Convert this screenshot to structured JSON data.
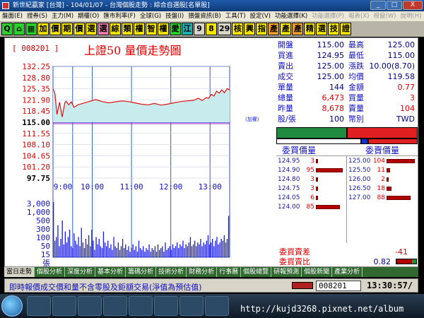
{
  "window": {
    "title": "新世紀贏家 [台灣] - 104/01/07 - 台灣個股走勢 : 綜合自選股[名單股]",
    "buttons": [
      "_",
      "□",
      "X"
    ]
  },
  "menu": [
    "盤面(E)",
    "證券(S)",
    "主力(M)",
    "期權(O)",
    "匯市利率(F)",
    "全球(G)",
    "技盤(I)",
    "損盤資訊(B)",
    "工具(T)",
    "設定(V)",
    "功能選擇(K)",
    "功能選擇(P)",
    "報表(X)",
    "視窗(W)",
    "說明(H)"
  ],
  "toolbar": [
    {
      "label": "Q",
      "color": "green"
    },
    {
      "label": "⌂",
      "color": "green"
    },
    {
      "label": "▦",
      "color": "green"
    },
    {
      "label": "加",
      "color": "yellow"
    },
    {
      "label": "價",
      "color": "yellow"
    },
    {
      "label": "期",
      "color": "yellow"
    },
    {
      "label": "價",
      "color": "yellow"
    },
    {
      "label": "選",
      "color": "yellow"
    },
    {
      "label": "選",
      "color": "pink"
    },
    {
      "label": "綜",
      "color": "yellow"
    },
    {
      "label": "類",
      "color": "yellow"
    },
    {
      "label": "權",
      "color": "yellow"
    },
    {
      "label": "智",
      "color": "yellow"
    },
    {
      "label": "權",
      "color": "yellow"
    },
    {
      "label": "愛",
      "color": "green"
    },
    {
      "label": "江",
      "color": "teal"
    },
    {
      "label": "9",
      "color": "lgray"
    },
    {
      "label": "8",
      "color": "yellow"
    },
    {
      "label": "29",
      "color": "lgray"
    },
    {
      "label": "核",
      "color": "yellow"
    },
    {
      "label": "興",
      "color": "yellow"
    },
    {
      "label": "指",
      "color": "yellow"
    },
    {
      "label": "產",
      "color": "orange"
    },
    {
      "label": "產",
      "color": "yellow"
    },
    {
      "label": "產",
      "color": "orange"
    },
    {
      "label": "精",
      "color": "yellow"
    },
    {
      "label": "選",
      "color": "yellow"
    },
    {
      "label": "技",
      "color": "yellow"
    },
    {
      "label": "證",
      "color": "yellow"
    }
  ],
  "stock_code": "[ 008201 ]",
  "chart_title": "上證50  量價走勢圖",
  "chart_data": {
    "type": "line",
    "price_axis": {
      "ticks": [
        132.25,
        128.8,
        125.35,
        121.9,
        118.45,
        115.0,
        111.55,
        108.1,
        104.65,
        101.2,
        97.75
      ],
      "tick_labels": [
        "132.25",
        "128.80",
        "125.35",
        "121.90",
        "118.45",
        "115.00",
        "111.55",
        "108.10",
        "104.65",
        "101.20",
        "97.75"
      ],
      "range": [
        97.75,
        132.25
      ],
      "reference": 115.0,
      "reference_note": "(加權)"
    },
    "volume_axis": {
      "tick_labels": [
        "3,000",
        "1,000",
        "500",
        "300",
        "100",
        "50",
        "15",
        "張"
      ],
      "scale": "log-like"
    },
    "x_axis": {
      "tick_labels": [
        "9:00",
        "10:00",
        "11:00",
        "12:00",
        "13:00"
      ],
      "range_minutes": [
        0,
        270
      ]
    },
    "series": [
      {
        "role": "price",
        "x": [
          0,
          3,
          6,
          10,
          14,
          18,
          20,
          24,
          28,
          32,
          38,
          45,
          55,
          65,
          75,
          85,
          95,
          105,
          115,
          125,
          135,
          145,
          155,
          165,
          175,
          185,
          195,
          205,
          215,
          222,
          228,
          234,
          238,
          242,
          246,
          250,
          254,
          258,
          262,
          266,
          270
        ],
        "y": [
          125.35,
          123.8,
          117.4,
          121.2,
          116.6,
          121.0,
          121.5,
          120.4,
          121.3,
          119.6,
          120.4,
          120.8,
          121.4,
          122.0,
          121.4,
          121.0,
          121.3,
          121.6,
          121.4,
          121.0,
          120.6,
          120.4,
          120.8,
          120.3,
          120.6,
          121.0,
          121.4,
          121.6,
          121.8,
          122.4,
          121.7,
          122.6,
          122.4,
          123.6,
          123.1,
          124.6,
          124.0,
          125.0,
          124.1,
          125.4,
          125.0
        ]
      },
      {
        "role": "average",
        "x": [
          0,
          270
        ],
        "y": [
          115.0,
          115.0
        ]
      }
    ],
    "volume_bars": [
      60,
      18,
      22,
      35,
      12,
      20,
      40,
      14,
      28,
      16,
      22,
      30,
      12,
      10,
      26,
      18,
      14,
      22,
      12,
      32,
      16,
      10,
      20,
      14,
      24,
      12,
      30,
      18,
      8,
      22,
      14,
      20,
      12,
      10,
      28,
      16,
      12,
      18,
      10,
      14,
      8,
      22,
      12,
      10,
      16,
      8,
      12,
      20,
      10,
      14,
      8,
      12,
      6,
      10,
      14,
      8,
      12,
      6,
      18,
      10,
      8,
      12,
      6,
      10,
      8,
      14,
      6,
      10,
      8,
      12,
      6,
      14,
      8,
      10,
      12,
      6,
      16,
      8,
      10,
      12,
      8,
      14,
      10,
      12,
      16,
      10,
      14,
      12,
      18,
      10,
      14,
      12,
      16,
      22,
      12,
      14,
      18,
      12,
      16,
      14,
      20,
      12,
      16,
      14,
      18,
      24,
      14,
      16,
      20,
      12,
      18,
      22,
      14,
      16,
      20,
      18,
      24,
      16,
      20,
      45
    ]
  },
  "quote": [
    {
      "l_label": "開盤",
      "l_value": "115.00",
      "l_color": "navy",
      "r_label": "最高",
      "r_value": "125.00",
      "r_color": "navy"
    },
    {
      "l_label": "買進",
      "l_value": "124.95",
      "l_color": "navy",
      "r_label": "最低",
      "r_value": "115.00",
      "r_color": "navy"
    },
    {
      "l_label": "賣出",
      "l_value": "125.00",
      "l_color": "navy",
      "r_label": "漲跌",
      "r_value": "10.00(8.70)",
      "r_color": "navy"
    },
    {
      "l_label": "成交",
      "l_value": "125.00",
      "l_color": "navy",
      "r_label": "均價",
      "r_value": "119.58",
      "r_color": "navy"
    },
    {
      "l_label": "單量",
      "l_value": "144",
      "l_color": "navy",
      "r_label": "金額",
      "r_value": "0.77",
      "r_color": "red"
    },
    {
      "l_label": "總量",
      "l_value": "6,473",
      "l_color": "red",
      "r_label": "買量",
      "r_value": "3",
      "r_color": "red"
    },
    {
      "l_label": "昨量",
      "l_value": "8,678",
      "l_color": "red",
      "r_label": "賣量",
      "r_value": "104",
      "r_color": "red"
    },
    {
      "l_label": "股/張",
      "l_value": "100",
      "l_color": "navy",
      "r_label": "幣別",
      "r_value": "TWD",
      "r_color": "navy"
    }
  ],
  "orderbook": {
    "headers": {
      "buy": "委買價量",
      "sell": "委賣價量"
    },
    "bids": [
      {
        "price": "124.95",
        "qty": "3",
        "fill": 0.05
      },
      {
        "price": "124.90",
        "qty": "95",
        "fill": 0.95
      },
      {
        "price": "124.80",
        "qty": "3",
        "fill": 0.05
      },
      {
        "price": "124.75",
        "qty": "3",
        "fill": 0.05
      },
      {
        "price": "124.05",
        "qty": "6",
        "fill": 0.08
      },
      {
        "price": "124.00",
        "qty": "85",
        "fill": 0.85
      }
    ],
    "asks": [
      {
        "price": "125.00",
        "qty": "104",
        "fill": 1.0
      },
      {
        "price": "125.50",
        "qty": "11",
        "fill": 0.12
      },
      {
        "price": "126.00",
        "qty": "2",
        "fill": 0.04
      },
      {
        "price": "126.50",
        "qty": "18",
        "fill": 0.18
      },
      {
        "price": "127.00",
        "qty": "88",
        "fill": 0.86
      },
      {
        "price": "",
        "qty": "",
        "fill": 0
      }
    ]
  },
  "stats": {
    "spread_label": "委買賣差",
    "spread_value": "-41",
    "ratio_label": "委買賣比",
    "ratio_value": "0.82"
  },
  "tabs": [
    "當日走勢",
    "個股分析",
    "深度分析",
    "基本分析",
    "籌碼分析",
    "技術分析",
    "財務分析",
    "行事曆",
    "個股總覽",
    "研報預測",
    "個股新聞",
    "產業分析"
  ],
  "status": {
    "text": "即時報價成交價和量不含零股及鉅額交易(淨值為預估值)",
    "code": "008201",
    "time": "13:30:57/"
  },
  "watermark": "http://kujd3268.pixnet.net/album"
}
